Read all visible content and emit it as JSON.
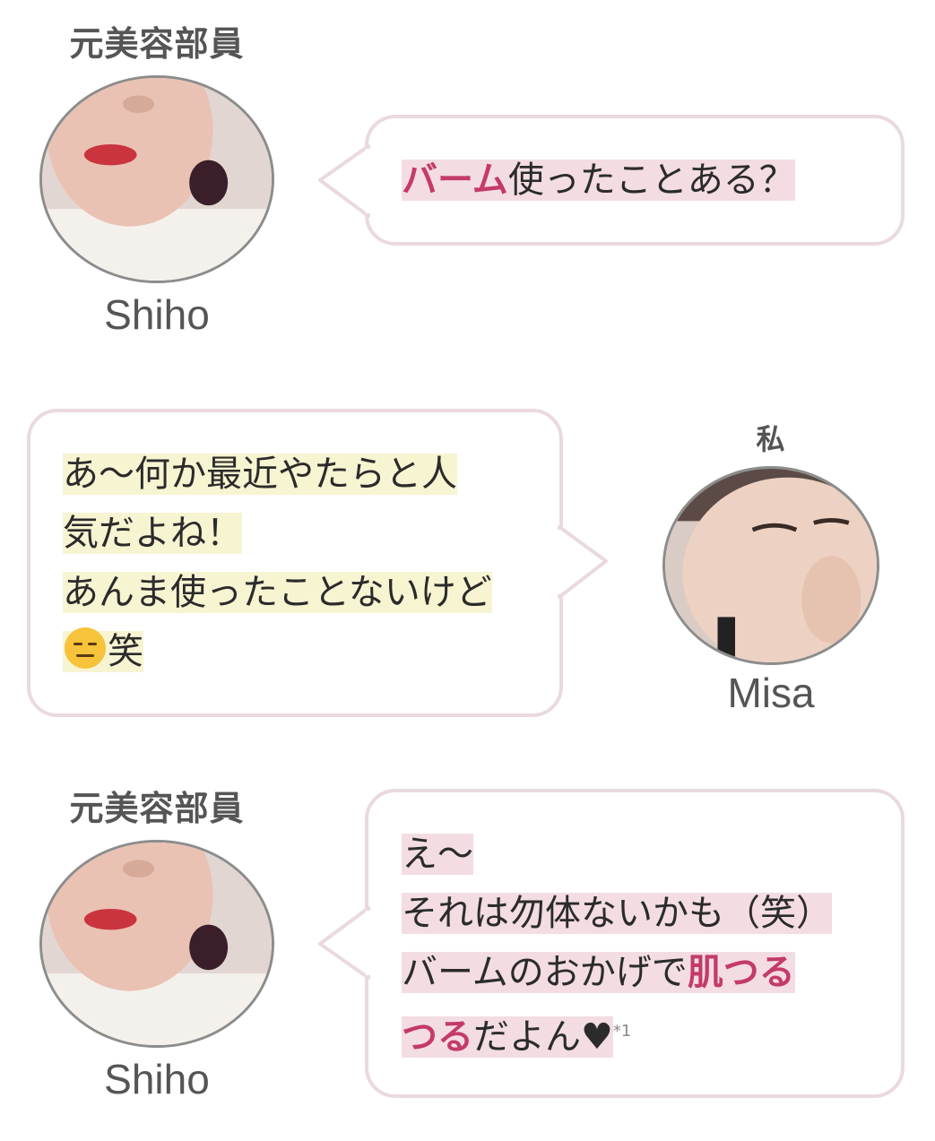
{
  "colors": {
    "accent": "#c43a6a",
    "bubble_border": "#ead9df",
    "highlight_pink": "#f3dde2",
    "highlight_yellow": "#f7f4d2"
  },
  "messages": [
    {
      "sender": {
        "role": "元美容部員",
        "name": "Shiho",
        "icon": "shiho-avatar"
      },
      "lines": [
        [
          {
            "t": "バーム",
            "accent": true
          },
          {
            "t": "使ったことある？"
          }
        ]
      ]
    },
    {
      "sender": {
        "role": "私",
        "name": "Misa",
        "icon": "misa-avatar"
      },
      "lines": [
        [
          {
            "t": "あ〜何か最近やたらと人"
          }
        ],
        [
          {
            "t": "気だよね！"
          }
        ],
        [
          {
            "t": "あんま使ったことないけど"
          }
        ],
        [
          {
            "emoji": "expressionless-face-emoji"
          },
          {
            "t": "笑"
          }
        ]
      ]
    },
    {
      "sender": {
        "role": "元美容部員",
        "name": "Shiho",
        "icon": "shiho-avatar"
      },
      "lines": [
        [
          {
            "t": "え〜"
          }
        ],
        [
          {
            "t": "それは勿体ないかも（笑）"
          }
        ],
        [
          {
            "t": "バームのおかげで"
          },
          {
            "t": "肌つる",
            "accent": true
          }
        ],
        [
          {
            "t": "つる",
            "accent": true
          },
          {
            "t": "だよん♥"
          },
          {
            "sup": "*1"
          }
        ]
      ]
    }
  ]
}
